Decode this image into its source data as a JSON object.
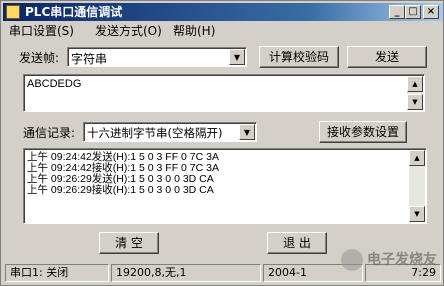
{
  "window": {
    "title": "PLC串口通信调试"
  },
  "titlebar_buttons": {
    "minimize": "_",
    "maximize": "□",
    "close": "×"
  },
  "menu": {
    "items": [
      "串口设置(S)",
      "发送方式(O)",
      "帮助(H)"
    ]
  },
  "send": {
    "frame_label": "发送帧:",
    "frame_type": "字符串",
    "checksum_button": "计算校验码",
    "send_button": "发送",
    "text": "ABCDEDG"
  },
  "log": {
    "label": "通信记录:",
    "format": "十六进制字节串(空格隔开)",
    "params_button": "接收参数设置",
    "lines": [
      "上午 09:24:42发送(H):1 5 0 3 FF 0 7C 3A",
      "上午 09:24:42接收(H):1 5 0 3 FF 0 7C 3A",
      "上午 09:26:29发送(H):1 5 0 3 0 0 3D CA",
      "上午 09:26:29接收(H):1 5 0 3 0 0 3D CA"
    ]
  },
  "buttons": {
    "clear": "清 空",
    "exit": "退 出"
  },
  "status": {
    "port": "串口1: 关闭",
    "settings": "19200,8,无,1",
    "date": "2004-1",
    "time": "7:29"
  },
  "watermark": {
    "text": "电子发烧友"
  }
}
